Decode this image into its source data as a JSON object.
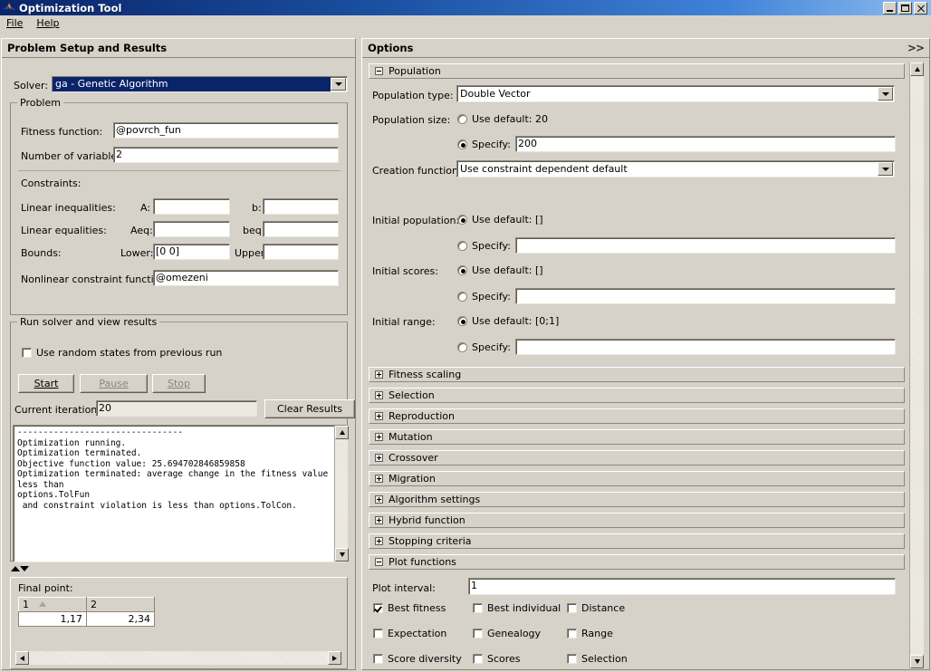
{
  "window": {
    "title": "Optimization Tool",
    "icon": "matlab-membrane-icon",
    "buttons": {
      "minimize": "minimize",
      "maximize": "maximize",
      "close": "close"
    }
  },
  "menubar": {
    "items": [
      "File",
      "Help"
    ]
  },
  "left_panel": {
    "header": "Problem Setup and Results",
    "solver": {
      "label": "Solver:",
      "value": "ga - Genetic Algorithm"
    },
    "problem": {
      "title": "Problem",
      "fitness_function": {
        "label": "Fitness function:",
        "value": "@povrch_fun"
      },
      "number_of_variables": {
        "label": "Number of variables:",
        "value": "2"
      },
      "constraints_label": "Constraints:",
      "linear_inequalities": {
        "label": "Linear inequalities:",
        "a_label": "A:",
        "a_value": "",
        "b_label": "b:",
        "b_value": ""
      },
      "linear_equalities": {
        "label": "Linear equalities:",
        "aeq_label": "Aeq:",
        "aeq_value": "",
        "beq_label": "beq:",
        "beq_value": ""
      },
      "bounds": {
        "label": "Bounds:",
        "lower_label": "Lower:",
        "lower_value": "[0 0]",
        "upper_label": "Upper:",
        "upper_value": ""
      },
      "nonlinear_constraint": {
        "label": "Nonlinear constraint function:",
        "value": "@omezeni"
      }
    },
    "run_solver": {
      "title": "Run solver and view results",
      "use_random_states": {
        "label": "Use random states from previous run",
        "checked": false
      },
      "start_button": "Start",
      "pause_button": "Pause",
      "stop_button": "Stop",
      "current_iteration_label": "Current iteration:",
      "current_iteration_value": "20",
      "clear_results_button": "Clear Results",
      "results_text": "--------------------------------\nOptimization running.\nOptimization terminated.\nObjective function value: 25.694702846859858\nOptimization terminated: average change in the fitness value less than\noptions.TolFun\n and constraint violation is less than options.TolCon."
    },
    "final_point": {
      "title": "Final point:",
      "columns": [
        "1",
        "2"
      ],
      "sorted_column": "1",
      "values": [
        "1,17",
        "2,34"
      ]
    }
  },
  "right_panel": {
    "header": "Options",
    "expand_label": ">>",
    "population": {
      "title": "Population",
      "expanded": true,
      "population_type": {
        "label": "Population type:",
        "value": "Double Vector"
      },
      "population_size": {
        "label": "Population size:",
        "use_default_label": "Use default: 20",
        "specify_label": "Specify:",
        "specify_value": "200",
        "selected": "specify"
      },
      "creation_function": {
        "label": "Creation function:",
        "value": "Use constraint dependent default"
      },
      "initial_population": {
        "label": "Initial population:",
        "use_default_label": "Use default: []",
        "specify_label": "Specify:",
        "specify_value": "",
        "selected": "default"
      },
      "initial_scores": {
        "label": "Initial scores:",
        "use_default_label": "Use default: []",
        "specify_label": "Specify:",
        "specify_value": "",
        "selected": "default"
      },
      "initial_range": {
        "label": "Initial range:",
        "use_default_label": "Use default: [0;1]",
        "specify_label": "Specify:",
        "specify_value": "",
        "selected": "default"
      }
    },
    "collapsed_sections": [
      "Fitness scaling",
      "Selection",
      "Reproduction",
      "Mutation",
      "Crossover",
      "Migration",
      "Algorithm settings",
      "Hybrid function",
      "Stopping criteria"
    ],
    "plot_functions": {
      "title": "Plot functions",
      "expanded": true,
      "plot_interval": {
        "label": "Plot interval:",
        "value": "1"
      },
      "checkboxes": [
        {
          "label": "Best fitness",
          "checked": true
        },
        {
          "label": "Best individual",
          "checked": false
        },
        {
          "label": "Distance",
          "checked": false
        },
        {
          "label": "Expectation",
          "checked": false
        },
        {
          "label": "Genealogy",
          "checked": false
        },
        {
          "label": "Range",
          "checked": false
        },
        {
          "label": "Score diversity",
          "checked": false
        },
        {
          "label": "Scores",
          "checked": false
        },
        {
          "label": "Selection",
          "checked": false
        }
      ]
    }
  },
  "colors": {
    "titlebar_start": "#0a246a",
    "titlebar_end": "#8fbdf0",
    "face": "#d6d2c9",
    "field": "#ffffff",
    "selection": "#0a246a",
    "border": "#8b8878"
  }
}
